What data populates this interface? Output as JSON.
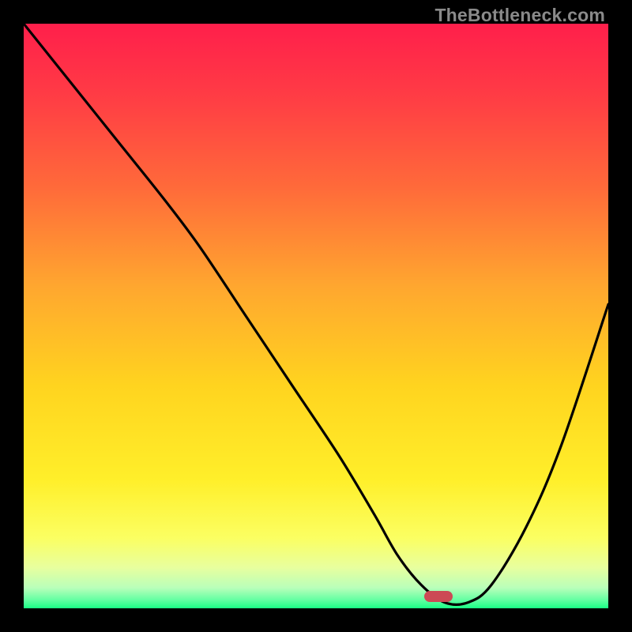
{
  "watermark": "TheBottleneck.com",
  "chart_data": {
    "type": "line",
    "title": "",
    "xlabel": "",
    "ylabel": "",
    "xlim": [
      0,
      100
    ],
    "ylim": [
      0,
      100
    ],
    "grid": false,
    "legend": false,
    "gradient_stops": [
      {
        "offset": 0.0,
        "color": "#ff1f4b"
      },
      {
        "offset": 0.12,
        "color": "#ff3b45"
      },
      {
        "offset": 0.28,
        "color": "#ff6a3a"
      },
      {
        "offset": 0.45,
        "color": "#ffa72f"
      },
      {
        "offset": 0.62,
        "color": "#ffd41f"
      },
      {
        "offset": 0.78,
        "color": "#ffef2a"
      },
      {
        "offset": 0.88,
        "color": "#fbff62"
      },
      {
        "offset": 0.93,
        "color": "#e8ff9e"
      },
      {
        "offset": 0.965,
        "color": "#b9ffba"
      },
      {
        "offset": 0.985,
        "color": "#66ffa3"
      },
      {
        "offset": 1.0,
        "color": "#1aff85"
      }
    ],
    "series": [
      {
        "name": "bottleneck-curve",
        "x": [
          0,
          8,
          16,
          24,
          30,
          38,
          46,
          54,
          60,
          64,
          68,
          72,
          76,
          80,
          86,
          92,
          100
        ],
        "y": [
          100,
          90,
          80,
          70,
          62,
          50,
          38,
          26,
          16,
          9,
          4,
          1,
          1,
          4,
          14,
          28,
          52
        ]
      }
    ],
    "marker": {
      "x": 71,
      "y": 2,
      "shape": "pill",
      "color": "#cc4a55"
    }
  }
}
